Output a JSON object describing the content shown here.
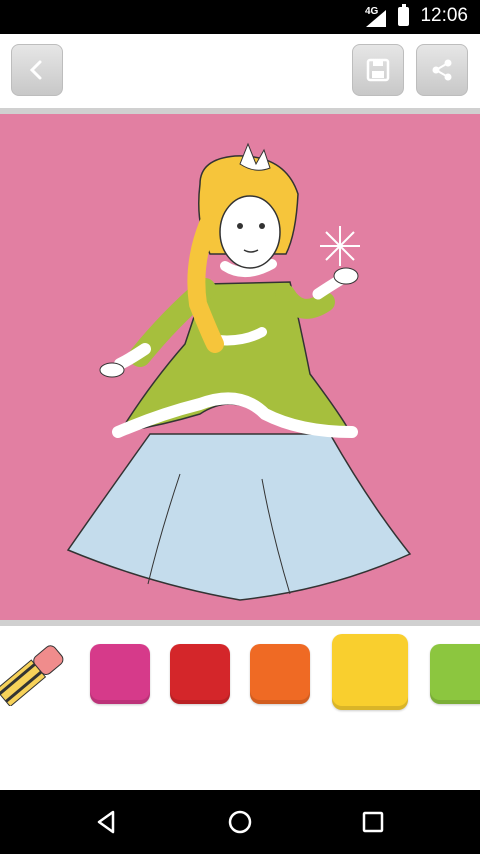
{
  "status_bar": {
    "network": "4G",
    "time": "12:06"
  },
  "toolbar": {
    "back_icon": "chevron-left-icon",
    "save_icon": "save-icon",
    "share_icon": "share-icon"
  },
  "canvas": {
    "background": "#e27fa2",
    "subject": "princess-coloring-image"
  },
  "palette": {
    "eraser_icon": "eraser-icon",
    "colors": [
      "#d63a8a",
      "#d4262a",
      "#ef6a24",
      "#f9cf2e",
      "#8cc63f"
    ],
    "selected_index": 3
  },
  "nav": {
    "back_icon": "nav-back-icon",
    "home_icon": "nav-home-icon",
    "recents_icon": "nav-recents-icon"
  }
}
